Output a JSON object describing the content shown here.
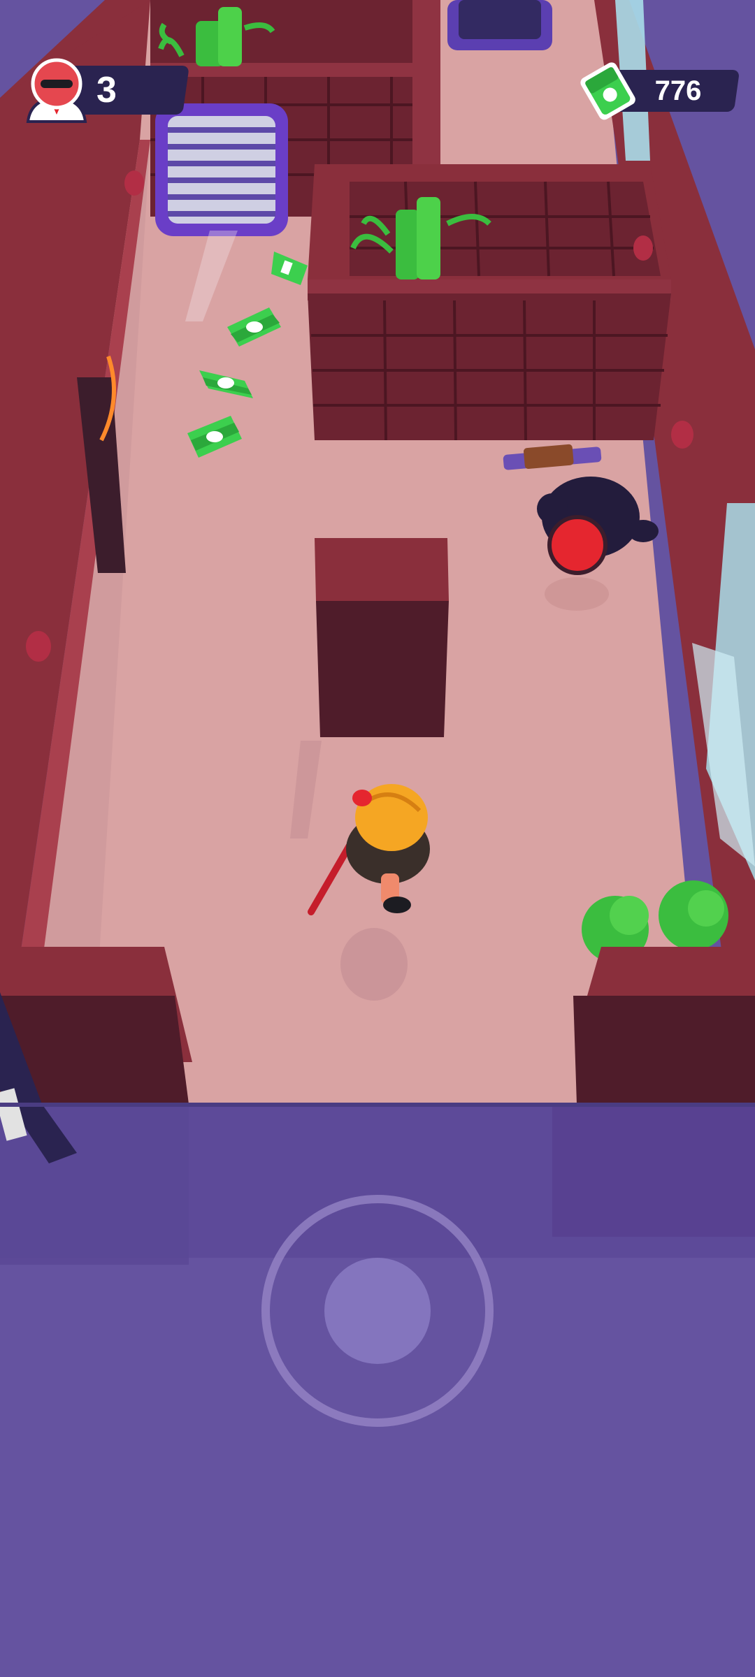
{
  "hud": {
    "targets_remaining": "3",
    "cash": "776",
    "target_icon": "masked-agent-icon",
    "cash_icon": "cash-stack-icon"
  },
  "colors": {
    "background": "#6553a0",
    "floor": "#d9a3a3",
    "wall": "#8a2f3c",
    "wall_dark": "#4f1c2a",
    "cash": "#3ccf4e",
    "hud_panel": "#2a2350"
  },
  "controls": {
    "joystick": "virtual-joystick"
  }
}
